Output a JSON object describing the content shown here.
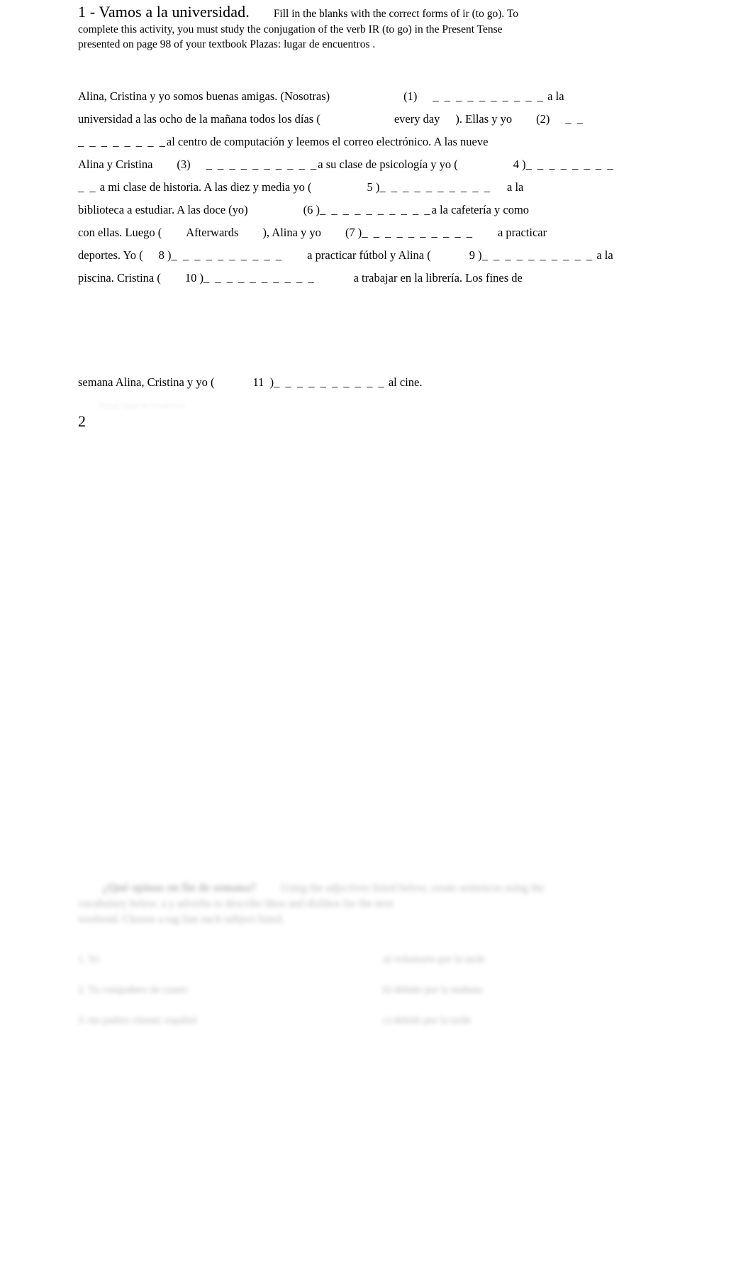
{
  "document": {
    "background_color": "#ffffff",
    "text_color": "#000000"
  },
  "activity1": {
    "number_title": "1 - Vamos a la universidad.",
    "instructions_line1": "Fill in the blanks with the correct forms of ir (to go).  To",
    "instructions_line2": "complete this activity, you must study the conjugation of the verb IR (to go) in the Present Tense",
    "instructions_line3": "presented on page 98 of your textbook Plazas: lugar de encuentros .",
    "lines": {
      "l1_a": "Alina, Cristina y yo somos buenas amigas. (Nosotras)",
      "l1_num": "(1)",
      "l1_blank": "_ _ _ _ _ _ _ _ _ _",
      "l1_b": "a la",
      "l2_a": "universidad a las ocho de la mañana todos los días (",
      "l2_hint": "every day",
      "l2_b": "). Ellas y yo",
      "l2_num": "(2)",
      "l2_blank": "_ _",
      "l3_blank": "_ _ _ _ _ _ _ _",
      "l3_a": "al centro de computación y leemos el correo electrónico. A las nueve",
      "l4_a": "Alina y Cristina",
      "l4_num": "(3)",
      "l4_blank": "_ _ _ _ _ _ _ _ _ _",
      "l4_b": "a su clase de psicología y yo (",
      "l4_num2": "4 )",
      "l4_blank2": "_ _ _ _ _ _ _ _",
      "l5_blank": "_ _",
      "l5_a": "a mi clase de historia. A las diez y media yo (",
      "l5_num": "5 )",
      "l5_blank2": "_ _ _ _ _ _ _ _ _ _",
      "l5_b": "a la",
      "l6_a": "biblioteca a estudiar. A las doce (yo)",
      "l6_num": "(6 )",
      "l6_blank": "_ _ _ _ _ _ _ _ _ _",
      "l6_b": "a la cafetería y como",
      "l7_a": "con ellas. Luego (",
      "l7_hint": "Afterwards",
      "l7_b": "), Alina y yo",
      "l7_num": "(7 )",
      "l7_blank": "_ _ _ _ _ _ _ _ _ _",
      "l7_c": "a practicar",
      "l8_a": "deportes. Yo (",
      "l8_num": "8 )",
      "l8_blank": "_ _ _ _ _ _ _ _ _ _",
      "l8_b": "a practicar fútbol y Alina (",
      "l8_num2": "9 )",
      "l8_blank2": "_ _ _ _ _ _ _ _ _ _",
      "l8_c": "a la",
      "l9_a": "piscina. Cristina (",
      "l9_num": "10 )",
      "l9_blank": "_ _ _ _ _ _ _ _ _ _",
      "l9_b": "a trabajar en la librería. Los fines de",
      "l10_a": "semana Alina, Cristina y yo (",
      "l10_num": "11  )",
      "l10_blank": "_ _ _ _ _ _ _ _ _ _",
      "l10_b": "al cine."
    }
  },
  "activity2": {
    "number": "2",
    "ghost_text": "Plazas: lugar de encuentros",
    "blurred_heading_line1_bold": "¿Qué opinas en fin de semana?",
    "blurred_heading_line1_rest": "Using the adjectives listed below, create sentences using the",
    "blurred_heading_line2": "vocabulary below.  a    y    adverbs     to describe likes and dislikes for the next",
    "blurred_heading_line3": "weekend.          Choose a tag line each subject listed.",
    "blurred_rows": [
      {
        "left": "1. Yo",
        "right": "a) voluntario por la tarde"
      },
      {
        "left": "2. Tu compañero de cuarto",
        "right": "b) debido por la mañana"
      },
      {
        "left": "3. tus padres vienen/ español",
        "right": "c) debido por la tarde"
      }
    ]
  }
}
